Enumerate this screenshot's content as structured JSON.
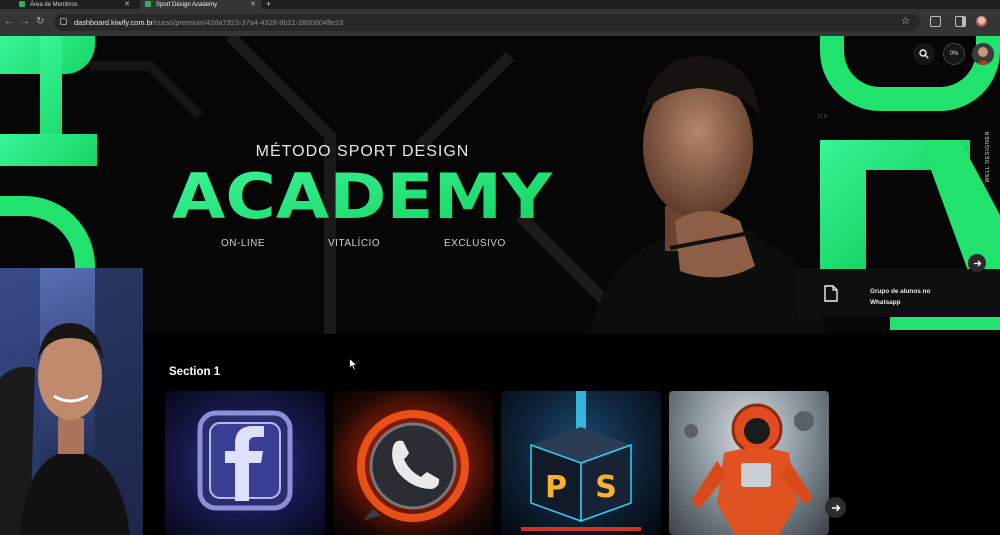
{
  "browser": {
    "tabs": [
      {
        "label": "Área de Membros"
      },
      {
        "label": "Sport Design Academy"
      }
    ],
    "url_host": "dashboard.kiwify.com.br",
    "url_path": "/curso/premium/42da7923-37a4-4328-8b21-2800604ffe23"
  },
  "hero": {
    "subtitle": "MÉTODO SPORT DESIGN",
    "title": "ACADEMY",
    "tags": [
      "ON-LINE",
      "VITALÍCIO",
      "EXCLUSIVO"
    ],
    "vertical_label": "WELL DESIGNER",
    "progress": "0%"
  },
  "whatsapp_card": {
    "label": "Grupo de alunos no Whatsapp"
  },
  "section": {
    "title": "Section 1",
    "cards": [
      {
        "icon": "facebook-icon"
      },
      {
        "icon": "whatsapp-icon"
      },
      {
        "icon": "photoshop-icon",
        "letters": [
          "P",
          "S"
        ]
      },
      {
        "icon": "astronaut-image"
      }
    ]
  },
  "colors": {
    "accent_green": "#22e572",
    "background": "#000000"
  }
}
